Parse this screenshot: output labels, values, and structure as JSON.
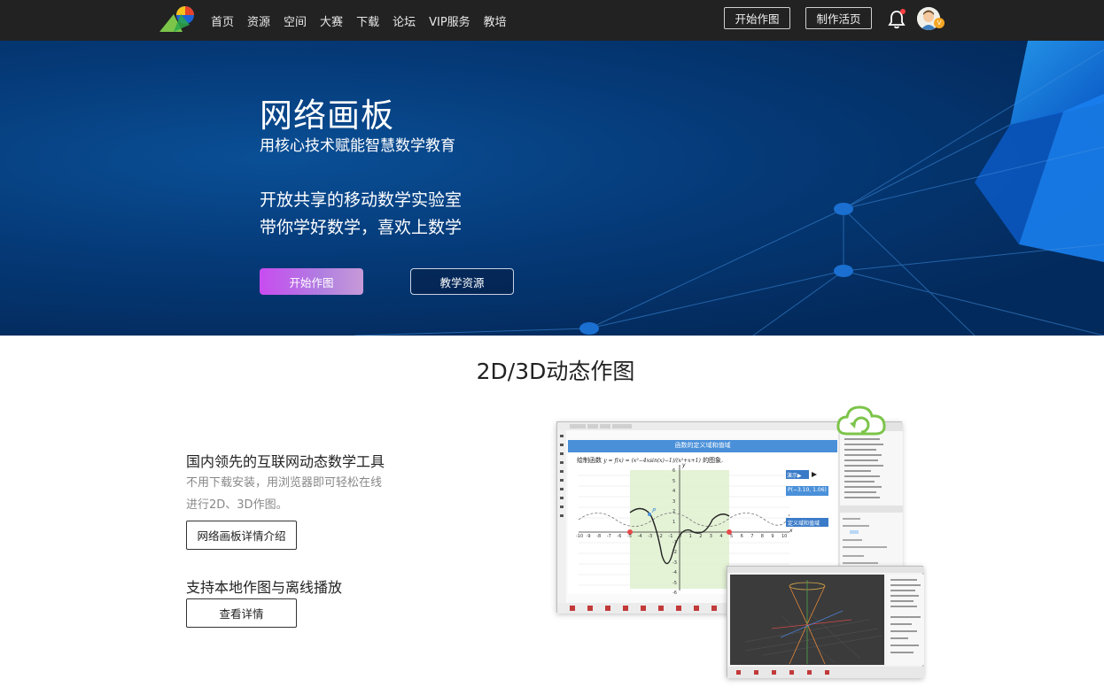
{
  "nav": {
    "links": [
      "首页",
      "资源",
      "空间",
      "大赛",
      "下载",
      "论坛",
      "VIP服务",
      "教培"
    ],
    "start_button": "开始作图",
    "make_page_button": "制作活页",
    "vip_badge": "V"
  },
  "hero": {
    "title": "网络画板",
    "subtitle": "用核心技术赋能智慧数学教育",
    "line1": "开放共享的移动数学实验室",
    "line2": "带你学好数学，喜欢上数学",
    "primary_button": "开始作图",
    "secondary_button": "教学资源"
  },
  "section": {
    "title": "2D/3D动态作图",
    "feature1": {
      "title": "国内领先的互联网动态数学工具",
      "desc_line1": "不用下载安装，用浏览器即可轻松在线",
      "desc_line2": "进行2D、3D作图。",
      "button": "网络画板详情介绍"
    },
    "feature2": {
      "title": "支持本地作图与离线播放",
      "button": "查看详情"
    }
  },
  "app_preview": {
    "banner": "函数的定义域和值域",
    "formula_prefix": "绘制函数",
    "formula": "y = f(x) = (x²−4xsin(x)−1)/(x²+x+1)",
    "formula_suffix": "的图象.",
    "demo_button": "演示▶",
    "point_label": "P(−3.10, 1.06)",
    "domain_range_button": "定义域和值域",
    "x_tick_labels": [
      "-10",
      "-9",
      "-8",
      "-7",
      "-6",
      "-5",
      "-4",
      "-3",
      "-2",
      "-1",
      "0",
      "1",
      "2",
      "3",
      "4",
      "5",
      "6",
      "7",
      "8",
      "9",
      "10"
    ],
    "y_tick_labels": [
      "6",
      "5",
      "4",
      "3",
      "2",
      "1",
      "-1",
      "-2",
      "-3",
      "-4",
      "-5",
      "-6"
    ],
    "axis_x": "x",
    "axis_y": "y",
    "point_name": "P"
  },
  "colors": {
    "nav_bg": "#222222",
    "hero_bg": "#053a78",
    "primary_gradient_start": "#c84cf0",
    "primary_gradient_end": "#c79ad8",
    "banner_blue": "#4a90d9",
    "cloud_green": "#7cc44a"
  }
}
